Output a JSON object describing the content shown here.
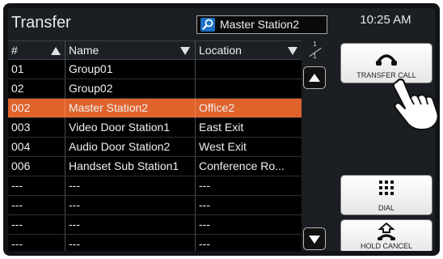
{
  "screen": {
    "title": "Transfer",
    "time": "10:25 AM",
    "search": {
      "value": "Master Station2",
      "icon": "search-icon"
    }
  },
  "table": {
    "columns": [
      {
        "label": "#",
        "sort": "up"
      },
      {
        "label": "Name",
        "sort": "down"
      },
      {
        "label": "Location",
        "sort": "down"
      }
    ],
    "page": {
      "current": "1",
      "total": "1"
    },
    "selected_index": 2,
    "rows": [
      {
        "num": "01",
        "name": "Group01",
        "location": ""
      },
      {
        "num": "02",
        "name": "Group02",
        "location": ""
      },
      {
        "num": "002",
        "name": "Master Station2",
        "location": "Office2"
      },
      {
        "num": "003",
        "name": "Video Door Station1",
        "location": "East Exit"
      },
      {
        "num": "004",
        "name": "Audio Door Station2",
        "location": "West Exit"
      },
      {
        "num": "006",
        "name": "Handset Sub Station1",
        "location": "Conference Ro..."
      },
      {
        "num": "---",
        "name": "---",
        "location": "---"
      },
      {
        "num": "---",
        "name": "---",
        "location": "---"
      },
      {
        "num": "---",
        "name": "---",
        "location": "---"
      },
      {
        "num": "---",
        "name": "---",
        "location": "---"
      }
    ]
  },
  "buttons": {
    "transfer_call": "TRANSFER CALL",
    "dial": "DIAL",
    "hold_cancel": "HOLD CANCEL"
  },
  "colors": {
    "selected_row": "#e0632c",
    "search_icon": "#1c6fc4"
  }
}
